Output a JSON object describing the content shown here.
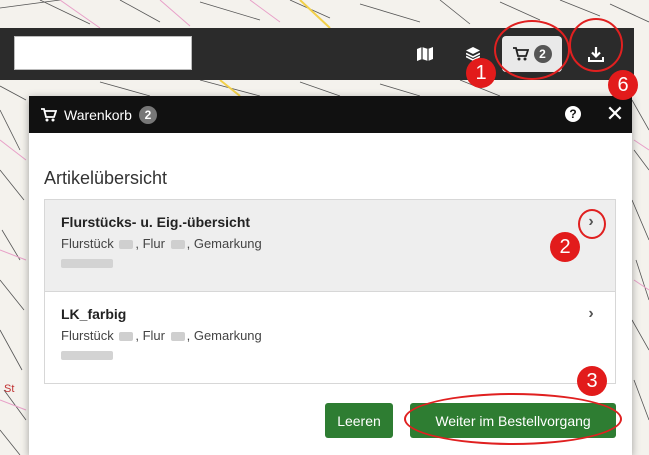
{
  "toolbar": {
    "search_value": "",
    "icons": [
      "map-icon",
      "layers-icon",
      "cart-icon",
      "download-icon"
    ],
    "cart_count": "2"
  },
  "cart_panel": {
    "title": "Warenkorb",
    "count": "2",
    "help_label": "?",
    "close_label": "✕",
    "overview_title": "Artikelübersicht",
    "items": [
      {
        "name": "Flurstücks- u. Eig.-übersicht",
        "detail_prefix": "Flurstück",
        "detail_mid": ", Flur",
        "detail_suffix": ", Gemarkung"
      },
      {
        "name": "LK_farbig",
        "detail_prefix": "Flurstück",
        "detail_mid": ", Flur",
        "detail_suffix": ", Gemarkung"
      }
    ],
    "clear_label": "Leeren",
    "continue_label": "Weiter im Bestellvorgang"
  },
  "annotations": {
    "marker_1": "1",
    "marker_2": "2",
    "marker_3": "3",
    "marker_6": "6",
    "color": "#e21b1b"
  },
  "colors": {
    "toolbar": "#2b2b2b",
    "panel_header": "#111111",
    "primary_button": "#2e7d32"
  }
}
